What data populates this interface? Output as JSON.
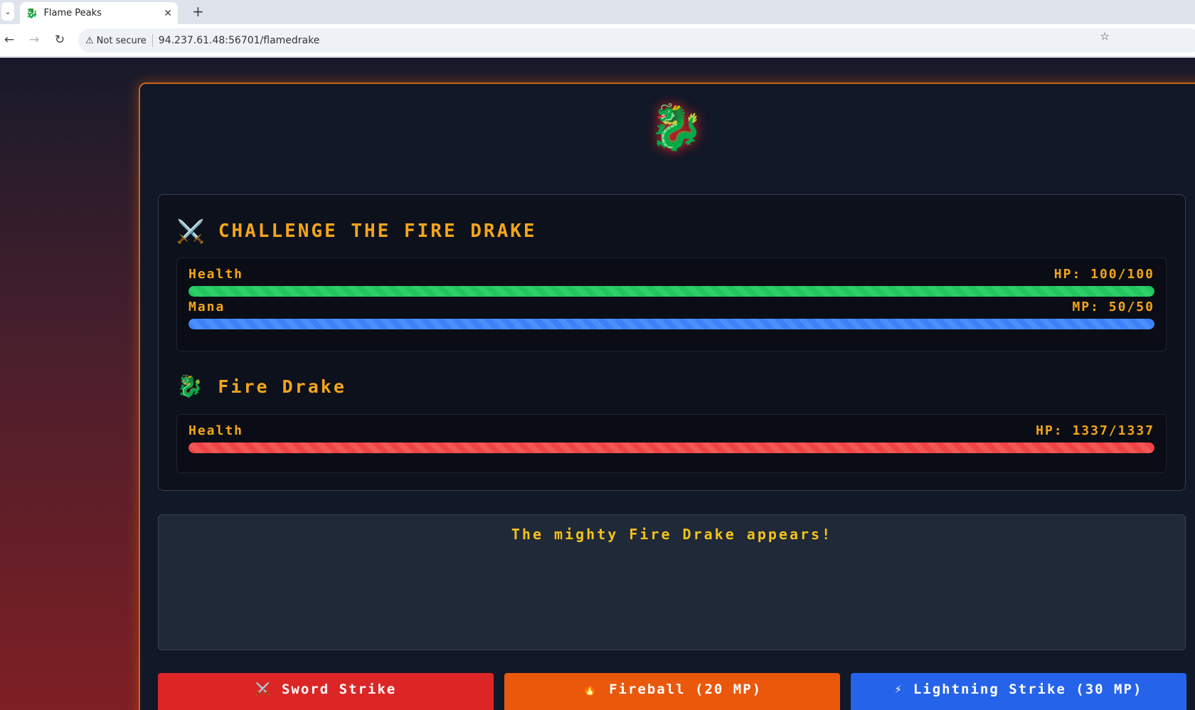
{
  "browser": {
    "tab_title": "Flame Peaks",
    "tab_favicon": "🐉",
    "security_label": "Not secure",
    "url": "94.237.61.48:56701/flamedrake"
  },
  "game": {
    "hero_icon": "🐉",
    "player": {
      "title": "CHALLENGE THE FIRE DRAKE",
      "title_icon": "⚔️",
      "health_label": "Health",
      "health_text": "HP: 100/100",
      "health_fraction": 1.0,
      "mana_label": "Mana",
      "mana_text": "MP: 50/50",
      "mana_fraction": 1.0
    },
    "enemy": {
      "title": "Fire Drake",
      "title_icon": "🐉",
      "health_label": "Health",
      "health_text": "HP: 1337/1337",
      "health_fraction": 1.0
    },
    "log_message": "The mighty Fire Drake appears!",
    "actions": [
      {
        "icon": "⚔️",
        "label": "Sword Strike"
      },
      {
        "icon": "🔥",
        "label": "Fireball (20 MP)"
      },
      {
        "icon": "⚡",
        "label": "Lightning Strike (30 MP)"
      }
    ]
  },
  "colors": {
    "accent_gold": "#f4a51c",
    "border_orange": "#c9651a",
    "health_green": "#22c55e",
    "mana_blue": "#3b82f6",
    "enemy_red": "#ef4444"
  }
}
